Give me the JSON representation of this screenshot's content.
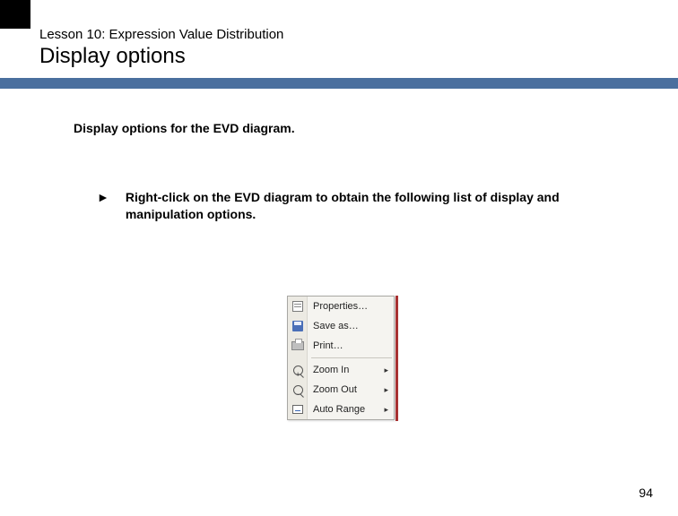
{
  "header": {
    "lesson_line": "Lesson 10: Expression Value Distribution",
    "title": "Display options"
  },
  "subheading": "Display options for the EVD diagram.",
  "bullet": {
    "marker": "►",
    "text": "Right-click on the EVD diagram to obtain the following list of display and manipulation options."
  },
  "context_menu": {
    "items": [
      {
        "label": "Properties…",
        "has_submenu": false,
        "icon": "properties-icon"
      },
      {
        "label": "Save as…",
        "has_submenu": false,
        "icon": "save-icon"
      },
      {
        "label": "Print…",
        "has_submenu": false,
        "icon": "print-icon"
      },
      {
        "sep": true
      },
      {
        "label": "Zoom In",
        "has_submenu": true,
        "icon": "zoom-in-icon"
      },
      {
        "label": "Zoom Out",
        "has_submenu": true,
        "icon": "zoom-out-icon"
      },
      {
        "label": "Auto Range",
        "has_submenu": true,
        "icon": "auto-range-icon"
      }
    ],
    "submenu_arrow": "▸"
  },
  "page_number": "94"
}
